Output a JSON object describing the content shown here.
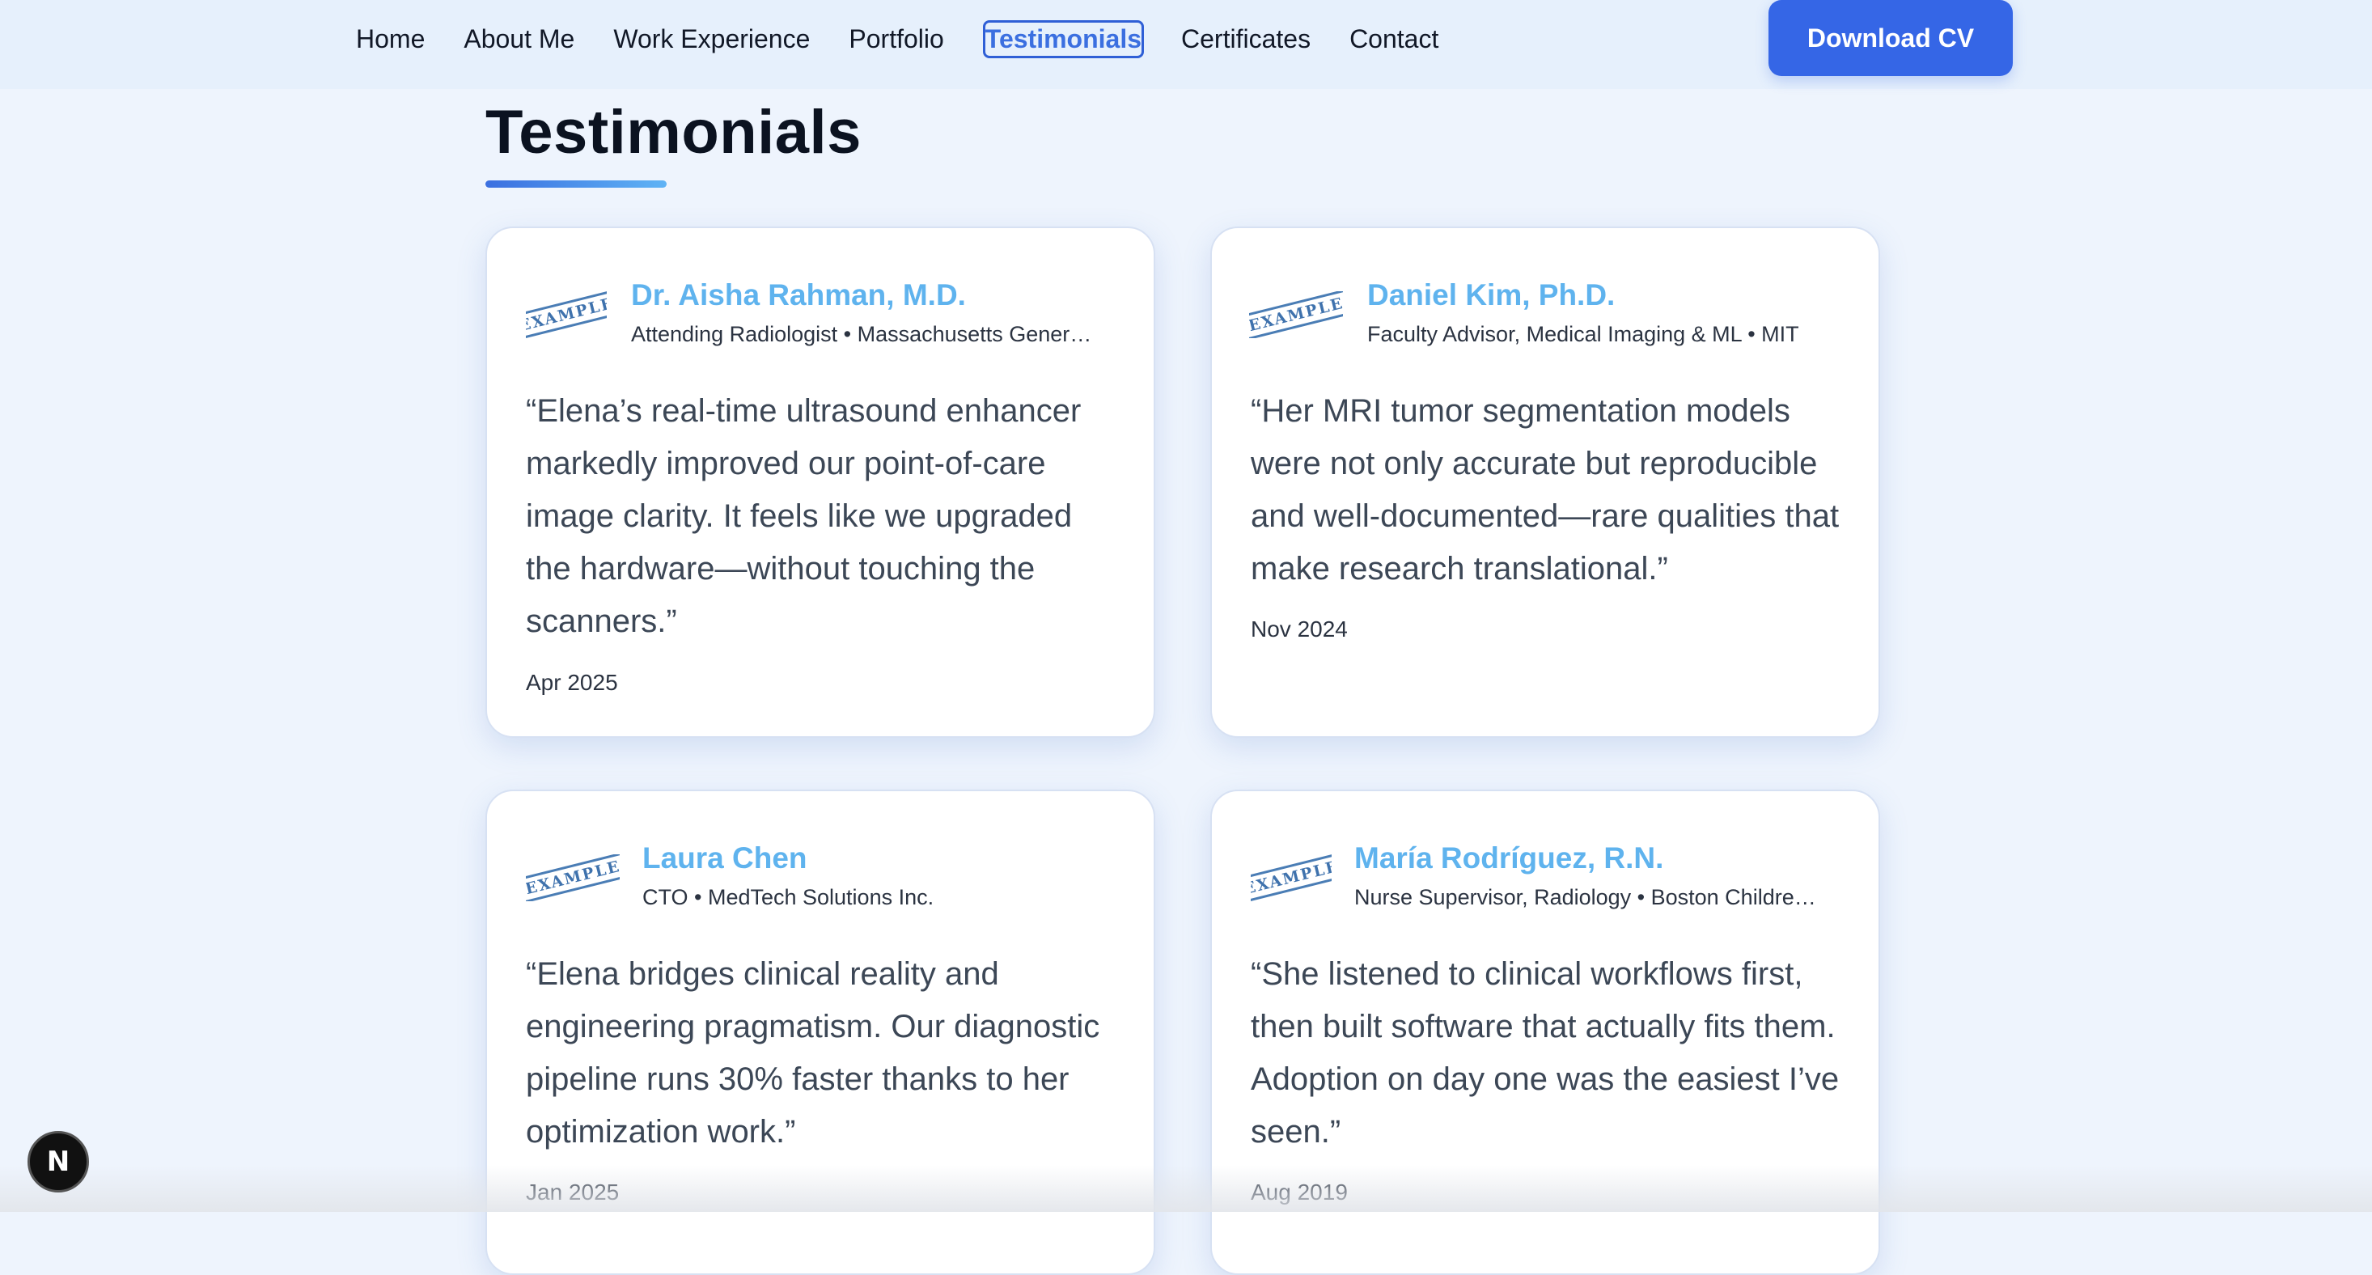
{
  "nav": {
    "items": [
      {
        "label": "Home"
      },
      {
        "label": "About Me"
      },
      {
        "label": "Work Experience"
      },
      {
        "label": "Portfolio"
      },
      {
        "label": "Testimonials",
        "active": true
      },
      {
        "label": "Certificates"
      },
      {
        "label": "Contact"
      }
    ],
    "cta_label": "Download CV"
  },
  "section": {
    "title": "Testimonials"
  },
  "testimonials": [
    {
      "stamp": "EXAMPLE",
      "name": "Dr. Aisha Rahman, M.D.",
      "role": "Attending Radiologist • Massachusetts Gener…",
      "quote": "“Elena’s real-time ultrasound enhancer markedly improved our point-of-care image clarity. It feels like we upgraded the hardware—without touching the scanners.”",
      "date": "Apr 2025"
    },
    {
      "stamp": "EXAMPLE",
      "name": "Daniel Kim, Ph.D.",
      "role": "Faculty Advisor, Medical Imaging & ML • MIT",
      "quote": "“Her MRI tumor segmentation models were not only accurate but reproducible and well-documented—rare qualities that make research translational.”",
      "date": "Nov 2024"
    },
    {
      "stamp": "EXAMPLE",
      "name": "Laura Chen",
      "role": "CTO • MedTech Solutions Inc.",
      "quote": "“Elena bridges clinical reality and engineering pragmatism. Our diagnostic pipeline runs 30% faster thanks to her optimization work.”",
      "date": "Jan 2025"
    },
    {
      "stamp": "EXAMPLE",
      "name": "María Rodríguez, R.N.",
      "role": "Nurse Supervisor, Radiology • Boston Childre…",
      "quote": "“She listened to clinical workflows first, then built software that actually fits them. Adoption on day one was the easiest I’ve seen.”",
      "date": "Aug 2019"
    }
  ],
  "dev_badge": {
    "letter": "N",
    "icon": "nextjs-dev-indicator-icon"
  },
  "colors": {
    "accent": "#3566e6",
    "name_blue": "#5fb3ee",
    "background": "#eef4fd"
  }
}
